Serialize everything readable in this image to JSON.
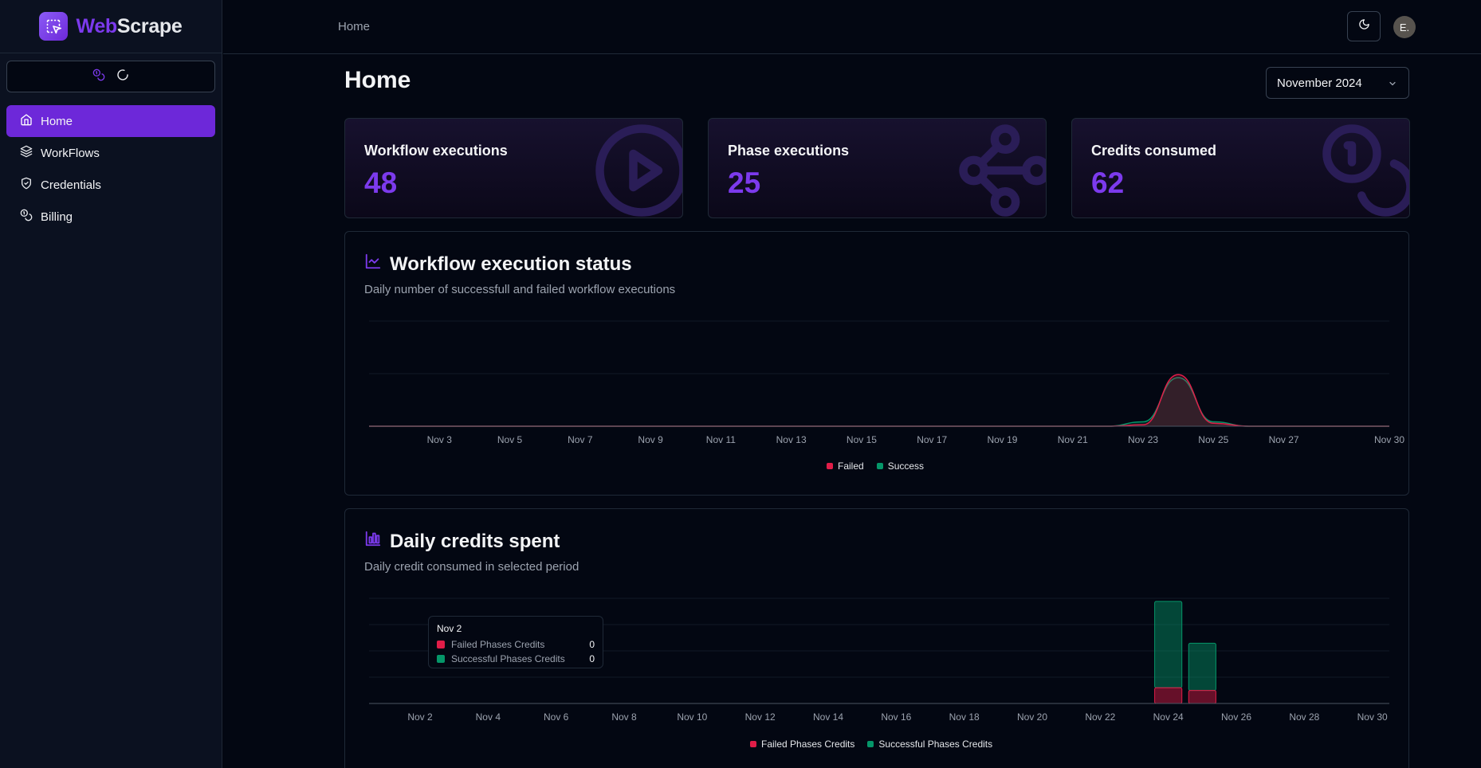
{
  "app": {
    "name_part1": "Web",
    "name_part2": "Scrape"
  },
  "sidebar": {
    "credits_icon": "coins-icon",
    "loading_icon": "loader-icon",
    "items": [
      {
        "label": "Home",
        "icon": "home-icon",
        "active": true
      },
      {
        "label": "WorkFlows",
        "icon": "layers-icon",
        "active": false
      },
      {
        "label": "Credentials",
        "icon": "shield-icon",
        "active": false
      },
      {
        "label": "Billing",
        "icon": "coins-icon",
        "active": false
      }
    ]
  },
  "header": {
    "breadcrumb": "Home",
    "avatar_initial": "E."
  },
  "page": {
    "title": "Home",
    "period": "November 2024"
  },
  "stats": [
    {
      "label": "Workflow executions",
      "value": "48",
      "icon": "play-circle-icon"
    },
    {
      "label": "Phase executions",
      "value": "25",
      "icon": "waypoints-icon"
    },
    {
      "label": "Credits consumed",
      "value": "62",
      "icon": "coins-icon"
    }
  ],
  "colors": {
    "accent": "#7c3aed",
    "failed": "#e11d48",
    "success": "#059669"
  },
  "chart_data": [
    {
      "type": "area",
      "title": "Workflow execution status",
      "subtitle": "Daily number of successfull and failed workflow executions",
      "x_ticks": [
        "Nov 3",
        "Nov 5",
        "Nov 7",
        "Nov 9",
        "Nov 11",
        "Nov 13",
        "Nov 15",
        "Nov 17",
        "Nov 19",
        "Nov 21",
        "Nov 23",
        "Nov 25",
        "Nov 27",
        "Nov 30"
      ],
      "x": [
        "Nov 1",
        "Nov 2",
        "Nov 3",
        "Nov 4",
        "Nov 5",
        "Nov 6",
        "Nov 7",
        "Nov 8",
        "Nov 9",
        "Nov 10",
        "Nov 11",
        "Nov 12",
        "Nov 13",
        "Nov 14",
        "Nov 15",
        "Nov 16",
        "Nov 17",
        "Nov 18",
        "Nov 19",
        "Nov 20",
        "Nov 21",
        "Nov 22",
        "Nov 23",
        "Nov 24",
        "Nov 25",
        "Nov 26",
        "Nov 27",
        "Nov 28",
        "Nov 29",
        "Nov 30"
      ],
      "series": [
        {
          "name": "Failed",
          "values": [
            0,
            0,
            0,
            0,
            0,
            0,
            0,
            0,
            0,
            0,
            0,
            0,
            0,
            0,
            0,
            0,
            0,
            0,
            0,
            0,
            0,
            0,
            1,
            35,
            2,
            0,
            0,
            0,
            0,
            0
          ]
        },
        {
          "name": "Success",
          "values": [
            0,
            0,
            0,
            0,
            0,
            0,
            0,
            0,
            0,
            0,
            0,
            0,
            0,
            0,
            0,
            0,
            0,
            0,
            0,
            0,
            0,
            0,
            3,
            33,
            3,
            0,
            0,
            0,
            0,
            0
          ]
        }
      ],
      "stacked": true,
      "legend": "bottom",
      "grid": true
    },
    {
      "type": "bar",
      "title": "Daily credits spent",
      "subtitle": "Daily credit consumed in selected period",
      "x_ticks": [
        "Nov 2",
        "Nov 4",
        "Nov 6",
        "Nov 8",
        "Nov 10",
        "Nov 12",
        "Nov 14",
        "Nov 16",
        "Nov 18",
        "Nov 20",
        "Nov 22",
        "Nov 24",
        "Nov 26",
        "Nov 28",
        "Nov 30"
      ],
      "categories": [
        "Nov 1",
        "Nov 2",
        "Nov 3",
        "Nov 4",
        "Nov 5",
        "Nov 6",
        "Nov 7",
        "Nov 8",
        "Nov 9",
        "Nov 10",
        "Nov 11",
        "Nov 12",
        "Nov 13",
        "Nov 14",
        "Nov 15",
        "Nov 16",
        "Nov 17",
        "Nov 18",
        "Nov 19",
        "Nov 20",
        "Nov 21",
        "Nov 22",
        "Nov 23",
        "Nov 24",
        "Nov 25",
        "Nov 26",
        "Nov 27",
        "Nov 28",
        "Nov 29",
        "Nov 30"
      ],
      "series": [
        {
          "name": "Failed Phases Credits",
          "values": [
            0,
            0,
            0,
            0,
            0,
            0,
            0,
            0,
            0,
            0,
            0,
            0,
            0,
            0,
            0,
            0,
            0,
            0,
            0,
            0,
            0,
            0,
            0,
            6,
            5,
            0,
            0,
            0,
            0,
            0
          ]
        },
        {
          "name": "Successful Phases Credits",
          "values": [
            0,
            0,
            0,
            0,
            0,
            0,
            0,
            0,
            0,
            0,
            0,
            0,
            0,
            0,
            0,
            0,
            0,
            0,
            0,
            0,
            0,
            0,
            0,
            33,
            18,
            0,
            0,
            0,
            0,
            0
          ]
        }
      ],
      "stacked": true,
      "legend": "bottom",
      "grid": true,
      "tooltip": {
        "title": "Nov 2",
        "rows": [
          {
            "label": "Failed Phases Credits",
            "value": "0"
          },
          {
            "label": "Successful Phases Credits",
            "value": "0"
          }
        ]
      }
    }
  ]
}
